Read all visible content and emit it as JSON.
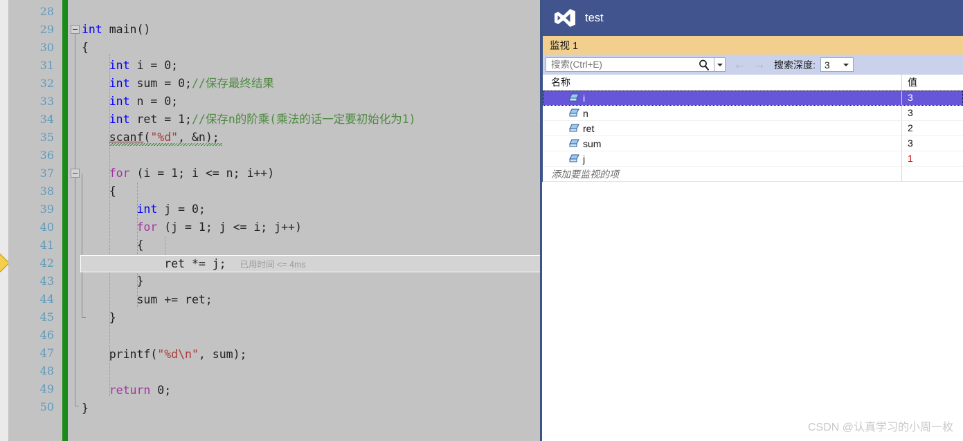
{
  "editor": {
    "first_line_number": 28,
    "current_execution_line": 42,
    "elapsed_annotation": "已用时间 <= 4ms",
    "lines": [
      {
        "num": "28",
        "text": ""
      },
      {
        "num": "29",
        "text": "int main()"
      },
      {
        "num": "30",
        "text": "{"
      },
      {
        "num": "31",
        "text": "int i = 0;"
      },
      {
        "num": "32",
        "text": "int sum = 0;//保存最终结果"
      },
      {
        "num": "33",
        "text": "int n = 0;"
      },
      {
        "num": "34",
        "text": "int ret = 1;//保存n的阶乘(乘法的话一定要初始化为1)"
      },
      {
        "num": "35",
        "text": "scanf(\"%d\", &n);"
      },
      {
        "num": "36",
        "text": ""
      },
      {
        "num": "37",
        "text": "for (i = 1; i <= n; i++)"
      },
      {
        "num": "38",
        "text": "{"
      },
      {
        "num": "39",
        "text": "int j = 0;"
      },
      {
        "num": "40",
        "text": "for (j = 1; j <= i; j++)"
      },
      {
        "num": "41",
        "text": "{"
      },
      {
        "num": "42",
        "text": "ret *= j;"
      },
      {
        "num": "43",
        "text": "}"
      },
      {
        "num": "44",
        "text": "sum += ret;"
      },
      {
        "num": "45",
        "text": "}"
      },
      {
        "num": "46",
        "text": ""
      },
      {
        "num": "47",
        "text": "printf(\"%d\\n\", sum);"
      },
      {
        "num": "48",
        "text": ""
      },
      {
        "num": "49",
        "text": "return 0;"
      },
      {
        "num": "50",
        "text": "}"
      }
    ]
  },
  "watch": {
    "window_title": "test",
    "logo_icon": "visual-studio-logo-icon",
    "tab_label": "监视 1",
    "search": {
      "placeholder": "搜索(Ctrl+E)",
      "value": "",
      "icon": "search-icon",
      "dropdown_icon": "chevron-down-icon"
    },
    "nav_back_icon": "arrow-left-icon",
    "nav_forward_icon": "arrow-right-icon",
    "depth_label": "搜索深度:",
    "depth_value": "3",
    "columns": [
      "名称",
      "值"
    ],
    "rows": [
      {
        "icon": "cube-icon",
        "name": "i",
        "value": "3",
        "selected": true,
        "modified": false
      },
      {
        "icon": "cube-icon",
        "name": "n",
        "value": "3",
        "selected": false,
        "modified": false
      },
      {
        "icon": "cube-icon",
        "name": "ret",
        "value": "2",
        "selected": false,
        "modified": false
      },
      {
        "icon": "cube-icon",
        "name": "sum",
        "value": "3",
        "selected": false,
        "modified": false
      },
      {
        "icon": "cube-icon",
        "name": "j",
        "value": "1",
        "selected": false,
        "modified": true
      }
    ],
    "add_row_placeholder": "添加要监视的项"
  },
  "watermark": "CSDN @认真学习的小周一枚",
  "colors": {
    "titlebar": "#41548d",
    "tabstrip": "#f2cf8c",
    "toolbar": "#c9d2ea",
    "selection": "#6657d8",
    "editor_bg": "#c3c3c3",
    "change_bar": "#1a8a1a",
    "keyword": "#0000ff",
    "keyword_control": "#a335a3",
    "comment": "#4c8a3f",
    "string": "#b03535",
    "modified_value": "#d40000",
    "line_number": "#5b9bbd"
  }
}
